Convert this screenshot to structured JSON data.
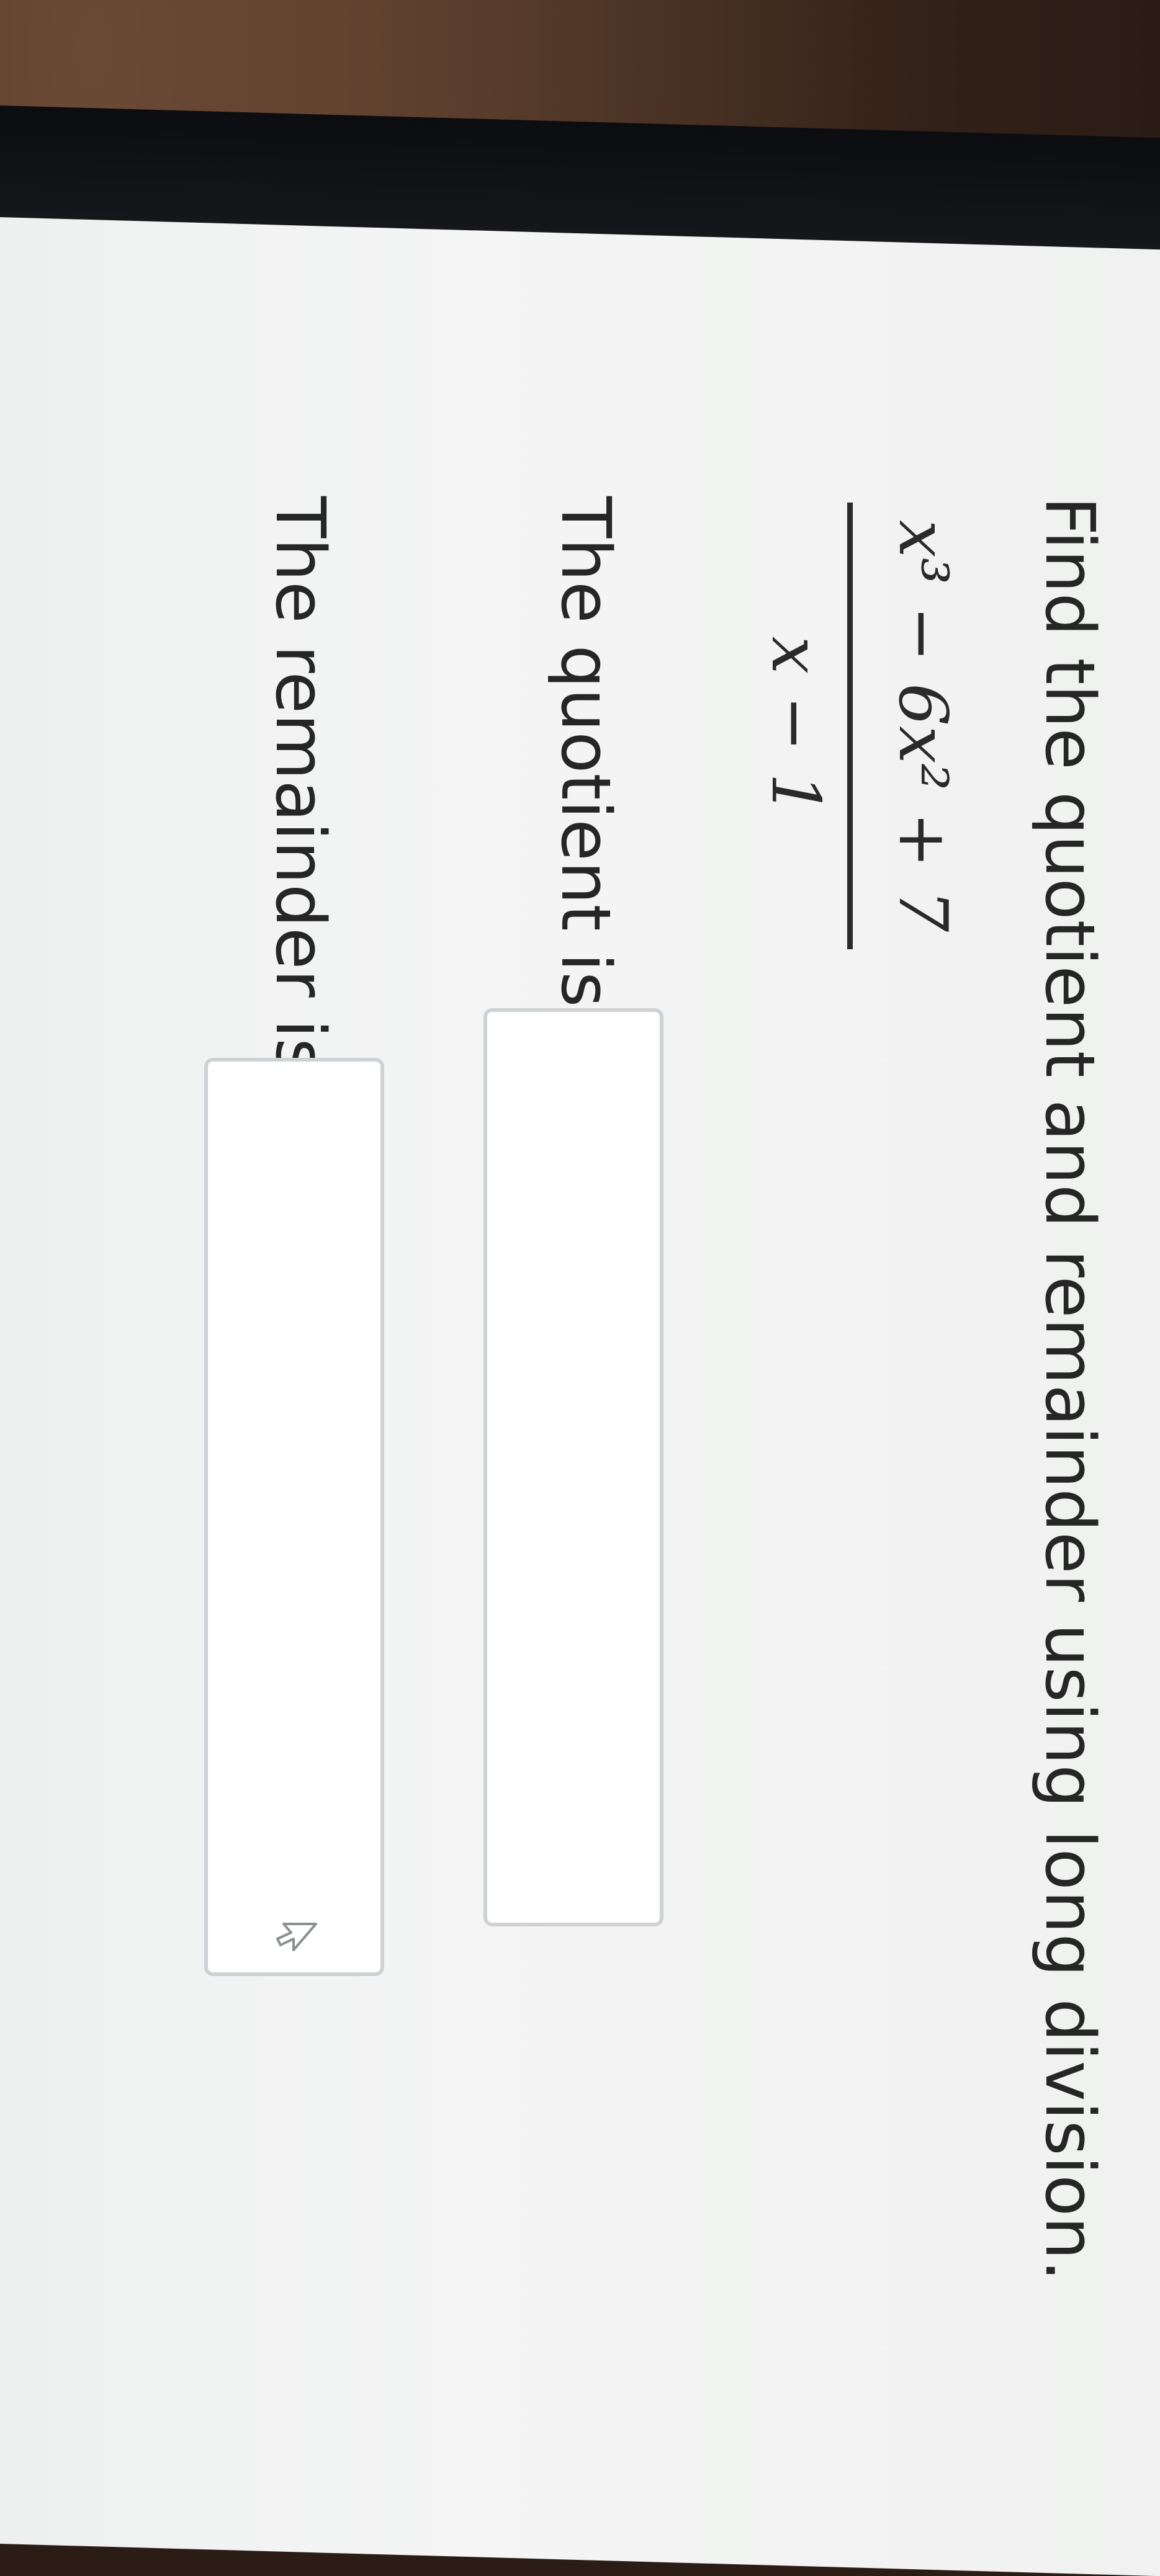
{
  "question": {
    "prompt": "Find the quotient and remainder using long division.",
    "numerator": "x³ − 6x² + 7",
    "denominator": "x − 1"
  },
  "answers": {
    "quotient_label": "The quotient is",
    "quotient_value": "",
    "remainder_label": "The remainder is",
    "remainder_value": ""
  },
  "icons": {
    "input_cursor": "cursor-arrow-icon"
  }
}
